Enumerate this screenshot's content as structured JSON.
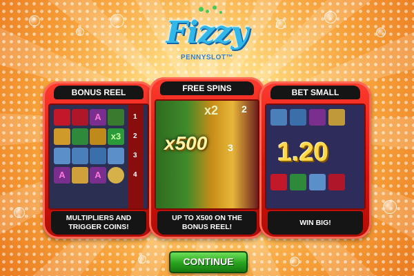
{
  "logo": {
    "title": "Fizzy",
    "subtitle": "PENNYSLOT™"
  },
  "cards": [
    {
      "title": "BONUS REEL",
      "description": "MULTIPLIERS AND\nTRIGGER COINS!"
    },
    {
      "title": "FREE SPINS",
      "description": "UP TO X500 ON THE\nBONUS REEL!"
    },
    {
      "title": "BET SMALL",
      "description": "WIN BIG!"
    }
  ],
  "scene1": {
    "reel_numbers": [
      "1",
      "2",
      "3",
      "4"
    ],
    "multiplier": "x3",
    "letter": "A"
  },
  "scene2": {
    "multiplier_top": "x2",
    "multiplier_big": "x500",
    "number_top": "2",
    "number_right": "3"
  },
  "scene3": {
    "win_amount": "1.20"
  },
  "continue_label": "CONTINUE",
  "colors": {
    "card_red": "#d8140c",
    "button_green": "#28a21d",
    "logo_blue": "#31b7e8"
  }
}
